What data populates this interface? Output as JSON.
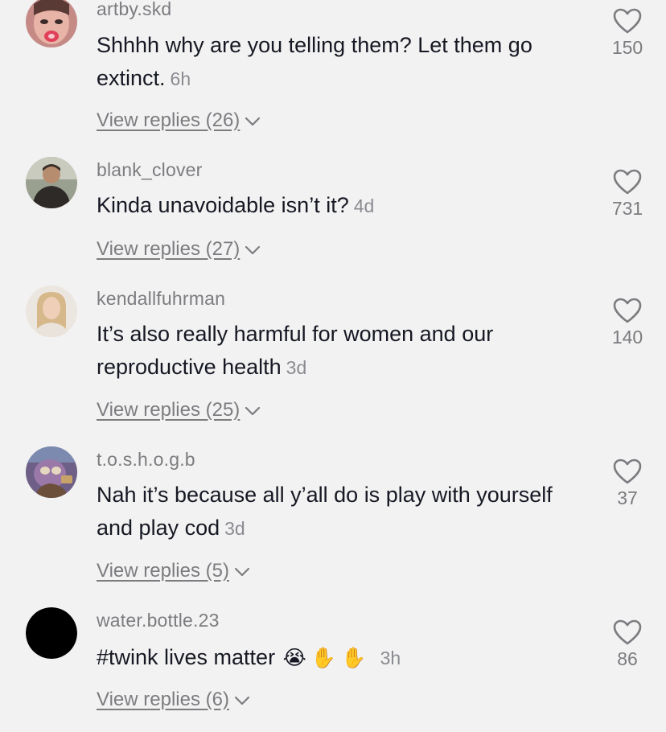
{
  "comments": [
    {
      "username": "artby.skd",
      "text": "Shhhh why are you telling them? Let them go extinct.",
      "time": "6h",
      "replies": "View replies (26)",
      "likes": "150",
      "avatar": "avatar-face-pink"
    },
    {
      "username": "blank_clover",
      "text": "Kinda unavoidable isn’t it?",
      "time": "4d",
      "replies": "View replies (27)",
      "likes": "731",
      "avatar": "avatar-man-dark-shirt"
    },
    {
      "username": "kendallfuhrman",
      "text": "It’s also really harmful for women and our reproductive health",
      "time": "3d",
      "replies": "View replies (25)",
      "likes": "140",
      "avatar": "avatar-blonde-woman"
    },
    {
      "username": "t.o.s.h.o.g.b",
      "text": "Nah it’s because all y’all do is play with yourself and play cod",
      "time": "3d",
      "replies": "View replies (5)",
      "likes": "37",
      "avatar": "avatar-cartoon-purple"
    },
    {
      "username": "water.bottle.23",
      "text": "#twink lives matter",
      "emojis": [
        "😭",
        "✋",
        "✋"
      ],
      "time": "3h",
      "replies": "View replies (6)",
      "likes": "86",
      "avatar": "avatar-black"
    }
  ],
  "colors": {
    "background": "#f2f2f2",
    "text": "#161823",
    "muted": "#7c7c80"
  }
}
